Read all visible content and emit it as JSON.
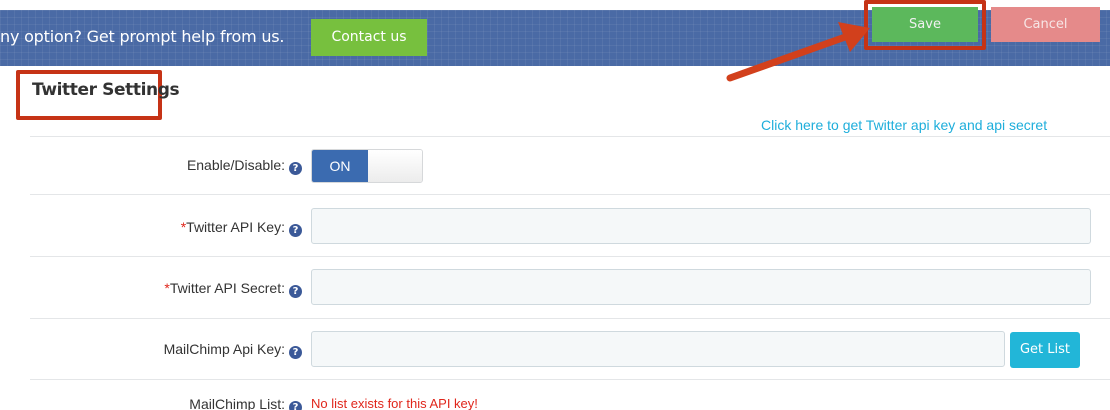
{
  "header": {
    "help_text": "ny option? Get prompt help from us.",
    "contact_label": "Contact us",
    "save_label": "Save",
    "cancel_label": "Cancel"
  },
  "settings": {
    "title": "Twitter Settings",
    "api_link": "Click here to get Twitter api key and api secret",
    "fields": {
      "enable": {
        "label": "Enable/Disable:",
        "toggle_value": "ON"
      },
      "api_key": {
        "required": "*",
        "label": "Twitter API Key:",
        "value": ""
      },
      "api_secret": {
        "required": "*",
        "label": "Twitter API Secret:",
        "value": ""
      },
      "mailchimp_key": {
        "label": "MailChimp Api Key:",
        "value": "",
        "button_label": "Get List"
      },
      "mailchimp_list": {
        "label": "MailChimp List:",
        "message": "No list exists for this API key!"
      }
    }
  },
  "icons": {
    "help": "question-circle-icon",
    "arrow": "annotation-arrow"
  },
  "colors": {
    "topbar": "#4a6aa5",
    "contact": "#77c03e",
    "save": "#5cb85c",
    "cancel": "#e58a8a",
    "highlight": "#c63316",
    "link": "#1eaedb",
    "error": "#e0261b"
  }
}
